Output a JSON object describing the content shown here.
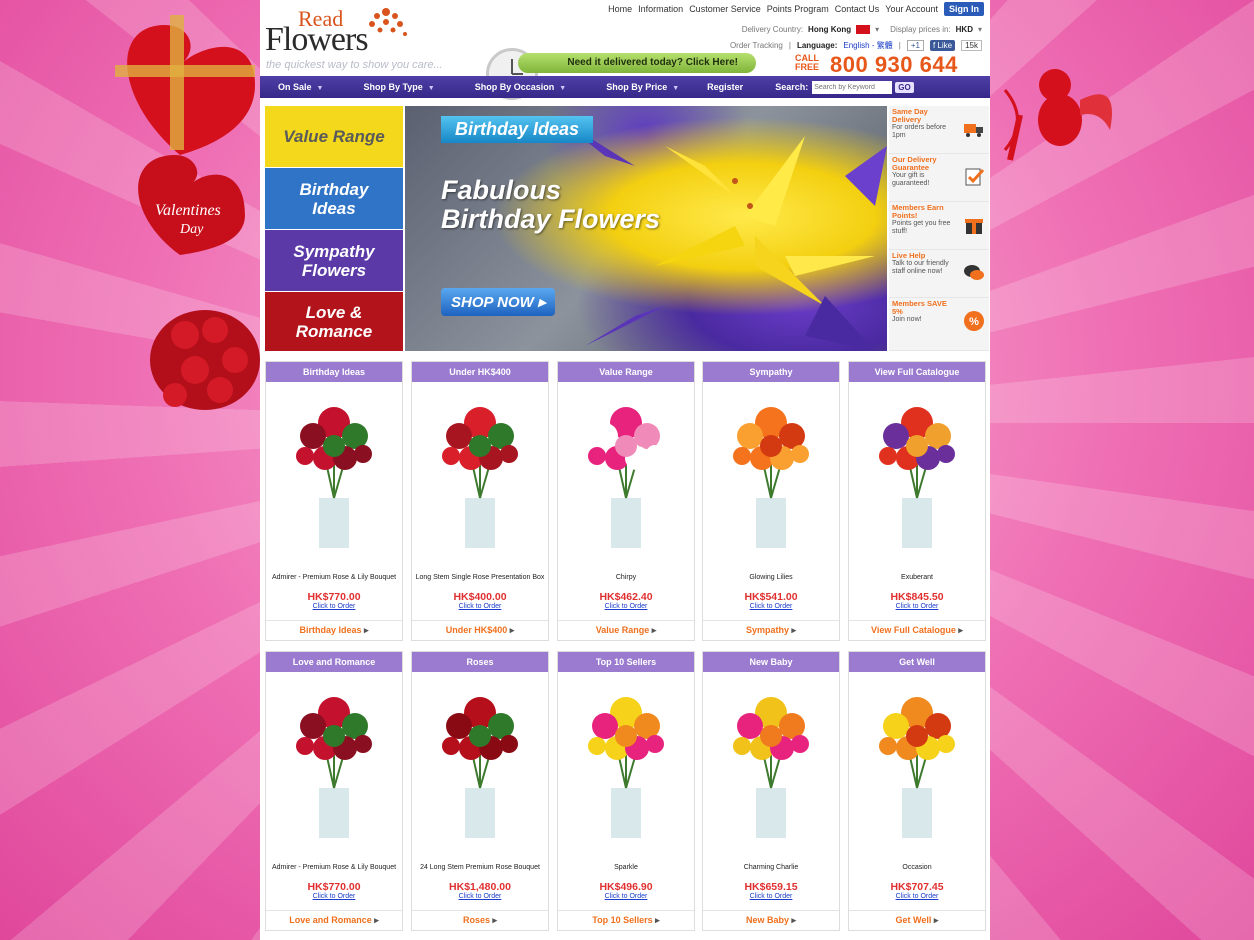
{
  "header": {
    "logo_top": "Read",
    "logo_bottom": "Flowers",
    "tagline": "the quickest way to show you care...",
    "top_links": [
      "Home",
      "Information",
      "Customer Service",
      "Points Program",
      "Contact Us",
      "Your Account"
    ],
    "sign_in": "Sign In",
    "delivery_country_label": "Delivery Country:",
    "delivery_country": "Hong Kong",
    "display_prices_label": "Display prices in:",
    "currency": "HKD",
    "order_tracking": "Order Tracking",
    "language_label": "Language:",
    "language": "English - 繁體",
    "gplus": "+1",
    "like": "Like",
    "like_count": "15k",
    "delivered_banner": "Need it delivered today? Click Here!",
    "call_free_1": "CALL",
    "call_free_2": "FREE",
    "phone": "800 930 644"
  },
  "nav": {
    "items": [
      "On Sale",
      "Shop By Type",
      "Shop By Occasion",
      "Shop By Price",
      "Register"
    ],
    "search_label": "Search:",
    "search_placeholder": "Search by Keyword",
    "go": "GO"
  },
  "banner": {
    "categories": [
      {
        "label": "Value Range",
        "color": "#f3d81b",
        "text_color": "#5a5a5a"
      },
      {
        "label": "Birthday Ideas",
        "color": "#2f74c7",
        "text_color": "#ffffff"
      },
      {
        "label": "Sympathy Flowers",
        "color": "#5b3aa8",
        "text_color": "#ffffff"
      },
      {
        "label": "Love & Romance",
        "color": "#b3141b",
        "text_color": "#ffffff"
      }
    ],
    "tag": "Birthday Ideas",
    "title_line1": "Fabulous",
    "title_line2": "Birthday Flowers",
    "shop_now": "SHOP NOW"
  },
  "features": [
    {
      "title": "Same Day Delivery",
      "desc": "For orders before 1pm",
      "icon": "delivery-truck-icon"
    },
    {
      "title": "Our Delivery Guarantee",
      "desc": "Your gift is guaranteed!",
      "icon": "guarantee-checkmark-icon"
    },
    {
      "title": "Members Earn Points!",
      "desc": "Points get you free stuff!",
      "icon": "gift-box-icon"
    },
    {
      "title": "Live Help",
      "desc": "Talk to our friendly staff online now!",
      "icon": "chat-bubble-icon"
    },
    {
      "title": "Members SAVE 5%",
      "desc": "Join now!",
      "icon": "percent-icon"
    }
  ],
  "products": [
    {
      "category": "Birthday Ideas",
      "name": "Admirer - Premium Rose & Lily Bouquet",
      "price": "HK$770.00",
      "order": "Click to Order",
      "footer": "Birthday Ideas",
      "colors": [
        "#c4122e",
        "#8a0f20",
        "#2f7a2a"
      ]
    },
    {
      "category": "Under HK$400",
      "name": "Long Stem Single Rose Presentation Box",
      "price": "HK$400.00",
      "order": "Click to Order",
      "footer": "Under HK$400",
      "colors": [
        "#d81f2a",
        "#a61520",
        "#2f7a2a"
      ]
    },
    {
      "category": "Value Range",
      "name": "Chirpy",
      "price": "HK$462.40",
      "order": "Click to Order",
      "footer": "Value Range",
      "colors": [
        "#e8237e",
        "#ffffff",
        "#f08ab8"
      ]
    },
    {
      "category": "Sympathy",
      "name": "Glowing Lilies",
      "price": "HK$541.00",
      "order": "Click to Order",
      "footer": "Sympathy",
      "colors": [
        "#f4731c",
        "#f9a030",
        "#d43a12"
      ]
    },
    {
      "category": "View Full Catalogue",
      "name": "Exuberant",
      "price": "HK$845.50",
      "order": "Click to Order",
      "footer": "View Full Catalogue",
      "colors": [
        "#e0301e",
        "#6b2f9c",
        "#f0a02c"
      ]
    },
    {
      "category": "Love and Romance",
      "name": "Admirer - Premium Rose & Lily Bouquet",
      "price": "HK$770.00",
      "order": "Click to Order",
      "footer": "Love and Romance",
      "colors": [
        "#c4122e",
        "#8a0f20",
        "#2f7a2a"
      ]
    },
    {
      "category": "Roses",
      "name": "24 Long Stem Premium Rose Bouquet",
      "price": "HK$1,480.00",
      "order": "Click to Order",
      "footer": "Roses",
      "colors": [
        "#b50f1c",
        "#8a0a14",
        "#2f7a2a"
      ]
    },
    {
      "category": "Top 10 Sellers",
      "name": "Sparkle",
      "price": "HK$496.90",
      "order": "Click to Order",
      "footer": "Top 10 Sellers",
      "colors": [
        "#f6d21a",
        "#e8237e",
        "#f08a1e"
      ]
    },
    {
      "category": "New Baby",
      "name": "Charming Charlie",
      "price": "HK$659.15",
      "order": "Click to Order",
      "footer": "New Baby",
      "colors": [
        "#f0c21a",
        "#e8237e",
        "#f07a1e"
      ]
    },
    {
      "category": "Get Well",
      "name": "Occasion",
      "price": "HK$707.45",
      "order": "Click to Order",
      "footer": "Get Well",
      "colors": [
        "#f08a1e",
        "#f6d21a",
        "#d43a12"
      ]
    }
  ]
}
